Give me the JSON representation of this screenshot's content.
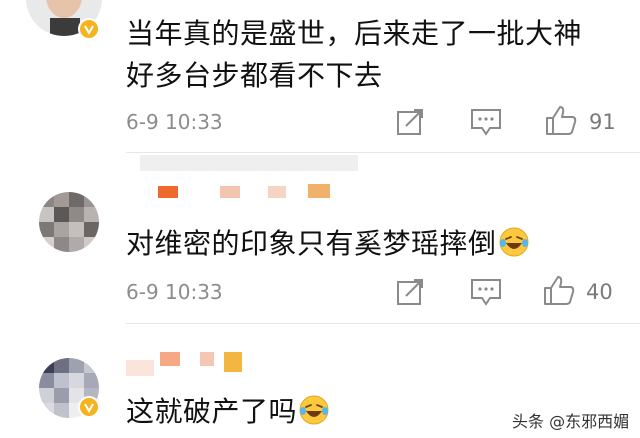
{
  "comments": [
    {
      "text_line1": "当年真的是盛世，后来走了一批大神",
      "text_line2": "好多台步都看不下去",
      "time": "6-9 10:33",
      "likes": "91",
      "avatar_icon": "user-photo-avatar",
      "verified": true
    },
    {
      "text": "对维密的印象只有奚梦瑶摔倒",
      "emoji": "laugh-cry-emoji",
      "time": "6-9 10:33",
      "likes": "40",
      "avatar_icon": "pixelated-avatar",
      "verified": false
    },
    {
      "text": "这就破产了吗",
      "emoji": "laugh-cry-emoji",
      "avatar_icon": "pixelated-avatar",
      "verified": true
    }
  ],
  "icons": {
    "share": "share-icon",
    "comment": "comment-icon",
    "like": "thumbs-up-icon"
  },
  "colors": {
    "verified_badge": "#f5b31f",
    "meta_text": "#8c8c8c",
    "emoji_face": "#ffc83d"
  },
  "watermark": "头条 @东邪西媚"
}
